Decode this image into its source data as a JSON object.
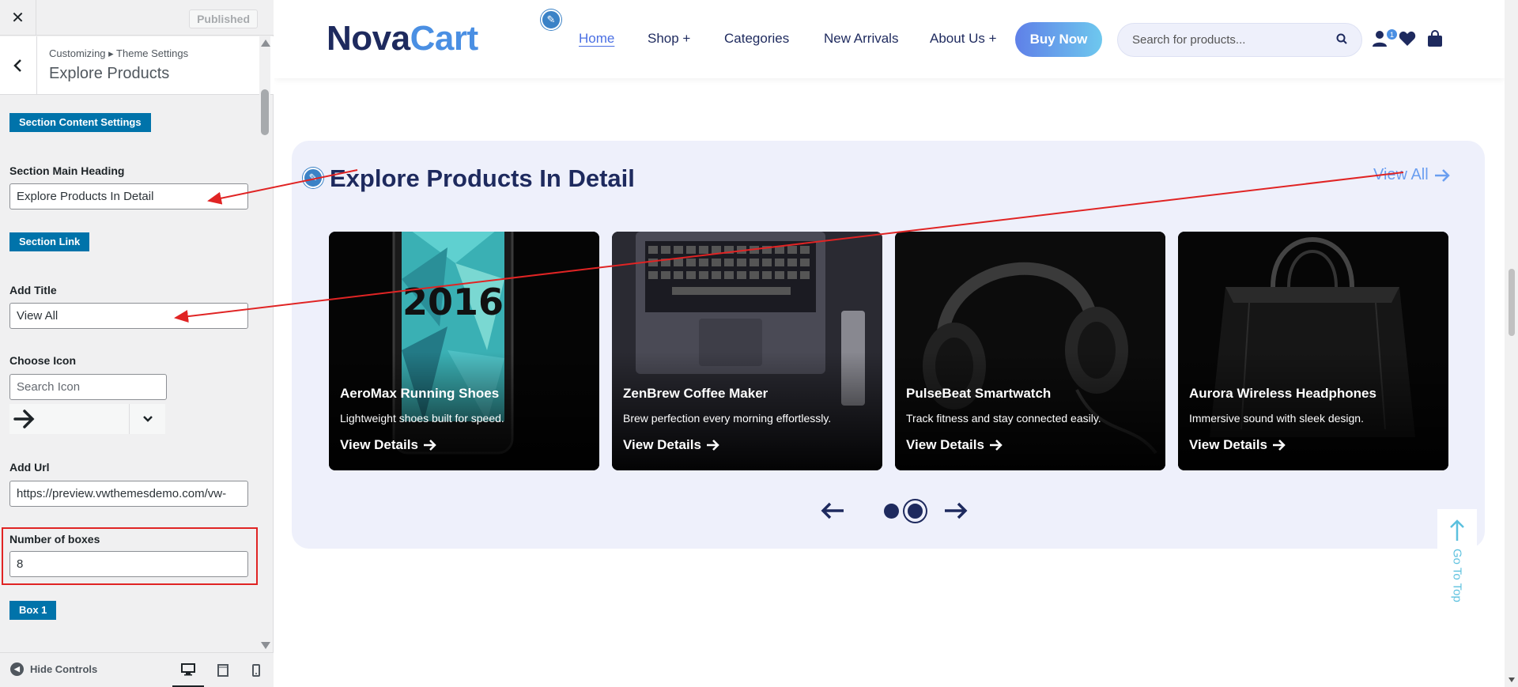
{
  "customizer": {
    "published_label": "Published",
    "breadcrumb": "Customizing ▸ Theme Settings",
    "title": "Explore Products",
    "section_content_badge": "Section Content Settings",
    "main_heading_label": "Section Main Heading",
    "main_heading_value": "Explore Products In Detail",
    "section_link_badge": "Section Link",
    "add_title_label": "Add Title",
    "add_title_value": "View All",
    "choose_icon_label": "Choose Icon",
    "icon_search_placeholder": "Search Icon",
    "selected_icon": "arrow-right-icon",
    "add_url_label": "Add Url",
    "add_url_value": "https://preview.vwthemesdemo.com/vw-",
    "num_boxes_label": "Number of boxes",
    "num_boxes_value": "8",
    "box1_badge": "Box 1",
    "hide_controls_label": "Hide Controls",
    "devices": [
      "desktop-icon",
      "tablet-icon",
      "mobile-icon"
    ]
  },
  "site": {
    "logo_part1": "Nova",
    "logo_part2": "Cart",
    "nav": [
      "Home",
      "Shop +",
      "Categories",
      "New Arrivals",
      "About Us +"
    ],
    "buy_now": "Buy Now",
    "search_placeholder": "Search for products...",
    "cart_count": "1",
    "colors": {
      "navy": "#1e2a5e",
      "accent": "#4a8fe3",
      "section_bg": "#eef0fb",
      "wp_blue": "#0073aa",
      "annotation_red": "#e02424"
    }
  },
  "section": {
    "heading": "Explore Products In Detail",
    "view_all": "View All",
    "cards": [
      {
        "title": "AeroMax Running Shoes",
        "desc": "Lightweight shoes built for speed.",
        "cta": "View Details"
      },
      {
        "title": "ZenBrew Coffee Maker",
        "desc": "Brew perfection every morning effortlessly.",
        "cta": "View Details"
      },
      {
        "title": "PulseBeat Smartwatch",
        "desc": "Track fitness and stay connected easily.",
        "cta": "View Details"
      },
      {
        "title": "Aurora Wireless Headphones",
        "desc": "Immersive sound with sleek design.",
        "cta": "View Details"
      }
    ],
    "phone_screen_text": "2016",
    "carousel_active_index": 2,
    "carousel_pages": 2
  },
  "go_top_label": "Go To Top"
}
